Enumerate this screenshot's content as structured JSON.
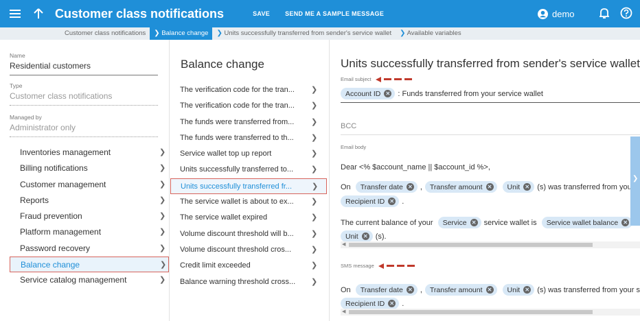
{
  "topbar": {
    "title": "Customer class notifications",
    "save_label": "SAVE",
    "sample_label": "SEND ME A SAMPLE MESSAGE",
    "user": "demo",
    "icons": [
      "menu-icon",
      "up-arrow-icon",
      "user-icon",
      "bell-icon",
      "help-icon"
    ]
  },
  "breadcrumb": [
    {
      "label": "Customer class notifications"
    },
    {
      "label": "Balance change"
    },
    {
      "label": "Units successfully transferred from sender's service wallet"
    },
    {
      "label": "Available variables"
    }
  ],
  "left": {
    "fields": [
      {
        "label": "Name",
        "value": "Residential customers"
      },
      {
        "label": "Type",
        "value": "Customer class notifications"
      },
      {
        "label": "Managed by",
        "value": "Administrator only"
      }
    ],
    "nav": [
      "Inventories management",
      "Billing notifications",
      "Customer management",
      "Reports",
      "Fraud prevention",
      "Platform management",
      "Password recovery",
      "Balance change",
      "Service catalog management"
    ],
    "active_index": 7
  },
  "middle": {
    "heading": "Balance change",
    "items": [
      "The verification code for the tran...",
      "The verification code for the tran...",
      "The funds were transferred from...",
      "The funds were transferred to th...",
      "Service wallet top up report",
      "Units successfully transferred to...",
      "Units successfully transferred fr...",
      "The service wallet is about to ex...",
      "The service wallet expired",
      "Volume discount threshold will b...",
      "Volume discount threshold cros...",
      "Credit limit exceeded",
      "Balance warning threshold cross..."
    ],
    "active_index": 6
  },
  "detail": {
    "heading": "Units successfully transferred from sender's service wallet",
    "subject_label": "Email subject",
    "subject_chip": "Account ID",
    "subject_text": ": Funds transferred from your service wallet",
    "bcc_label": "BCC",
    "body_label": "Email body",
    "body_greeting": "Dear <% $account_name || $account_id %>,",
    "body_on": "On",
    "chips": {
      "transfer_date": "Transfer date",
      "transfer_amount": "Transfer amount",
      "unit": "Unit",
      "recipient_id": "Recipient ID",
      "service": "Service",
      "service_wallet_balance": "Service wallet balance"
    },
    "comma": ",",
    "transferred_text": "(s) was transferred from your servic",
    "period": ".",
    "balance_prefix": "The current balance of your",
    "balance_mid": "service wallet is",
    "units_suffix": "(s).",
    "sms_label": "SMS message"
  },
  "colors": {
    "accent": "#1f8fd8",
    "highlight_border": "#d7635b",
    "arrow": "#c0392b",
    "chip_bg": "#d8e8f6"
  }
}
